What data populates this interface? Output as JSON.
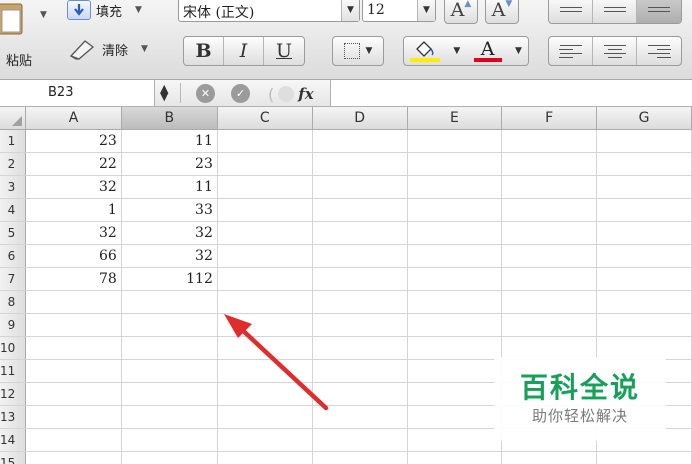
{
  "ribbon": {
    "paste_label": "粘贴",
    "fill_label": "填充",
    "clear_label": "清除",
    "font_name": "宋体 (正文)",
    "font_size": "12",
    "grow_font_label": "A",
    "shrink_font_label": "A",
    "bold_label": "B",
    "italic_label": "I",
    "underline_label": "U",
    "font_color_label": "A",
    "fill_color": "#ffee00",
    "font_color": "#e0001b"
  },
  "formula_bar": {
    "cell_reference": "B23",
    "function_label": "fx",
    "formula_value": ""
  },
  "sheet": {
    "columns": [
      "A",
      "B",
      "C",
      "D",
      "E",
      "F",
      "G"
    ],
    "selected_column": "B",
    "row_labels": [
      "1",
      "2",
      "3",
      "4",
      "5",
      "6",
      "7",
      "8",
      "9",
      "10",
      "11",
      "12",
      "13",
      "14",
      "15"
    ],
    "rows": [
      [
        "23",
        "11"
      ],
      [
        "22",
        "23"
      ],
      [
        "32",
        "11"
      ],
      [
        "1",
        "33"
      ],
      [
        "32",
        "32"
      ],
      [
        "66",
        "32"
      ],
      [
        "78",
        "112"
      ]
    ]
  },
  "annotation": {
    "arrow_color": "#e02c2c"
  },
  "watermark": {
    "title": "百科全说",
    "subtitle": "助你轻松解决",
    "title_color": "#16a05a"
  }
}
